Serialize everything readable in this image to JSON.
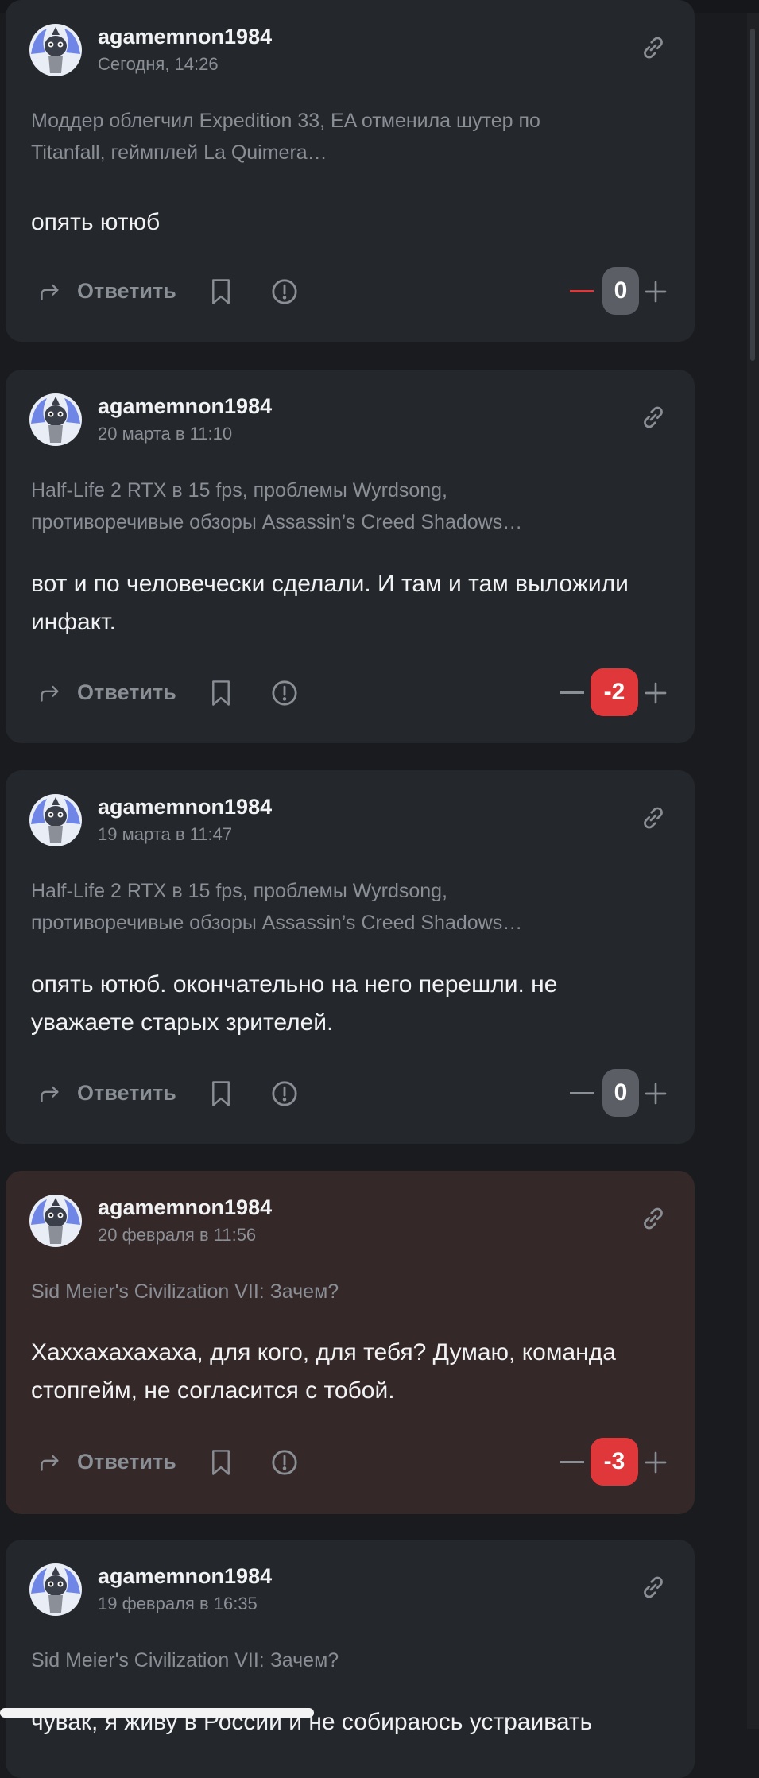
{
  "colors": {
    "page_bg": "#191b1e",
    "card_bg": "#24272b",
    "card_negative_bg": "#352828",
    "muted_text": "#8a8e95",
    "rating_neutral": "#5b5f65",
    "rating_negative": "#e0383a",
    "downvote_active": "#e0383a"
  },
  "icons": {
    "reply": "reply-arrow-icon",
    "bookmark": "bookmark-icon",
    "report": "exclamation-circle-icon",
    "upvote": "plus-icon",
    "downvote": "minus-icon",
    "link": "link-chain-icon"
  },
  "comments": [
    {
      "author": "agamemnon1984",
      "date": "Сегодня, 14:26",
      "source": "Моддер облегчил Expedition 33, EA отменила шутер по Titanfall, геймплей La Quimera…",
      "text": "опять ютюб",
      "reply_label": "Ответить",
      "rating": "0",
      "rating_state": "neutral",
      "downvoted": true
    },
    {
      "author": "agamemnon1984",
      "date": "20 марта в 11:10",
      "source": "Half-Life 2 RTX в 15 fps, проблемы Wyrdsong, противоречивые обзоры Assassin’s Creed Shadows…",
      "text": "вот и по человечески сделали. И там и там выложили инфакт.",
      "reply_label": "Ответить",
      "rating": "-2",
      "rating_state": "negative",
      "downvoted": false
    },
    {
      "author": "agamemnon1984",
      "date": "19 марта в 11:47",
      "source": "Half-Life 2 RTX в 15 fps, проблемы Wyrdsong, противоречивые обзоры Assassin’s Creed Shadows…",
      "text": "опять ютюб. окончательно на него перешли. не уважаете старых зрителей.",
      "reply_label": "Ответить",
      "rating": "0",
      "rating_state": "neutral",
      "downvoted": false
    },
    {
      "author": "agamemnon1984",
      "date": "20 февраля в 11:56",
      "source": "Sid Meier's Civilization VII: Зачем?",
      "text": "Хаххахахахаха, для кого, для тебя? Думаю, команда стопгейм, не согласится с тобой.",
      "reply_label": "Ответить",
      "rating": "-3",
      "rating_state": "negative",
      "downvoted": false
    },
    {
      "author": "agamemnon1984",
      "date": "19 февраля в 16:35",
      "source": "Sid Meier's Civilization VII: Зачем?",
      "text": "чувак, я живу в России и не собираюсь устраивать",
      "reply_label": "",
      "rating": "",
      "rating_state": "",
      "downvoted": false
    }
  ]
}
